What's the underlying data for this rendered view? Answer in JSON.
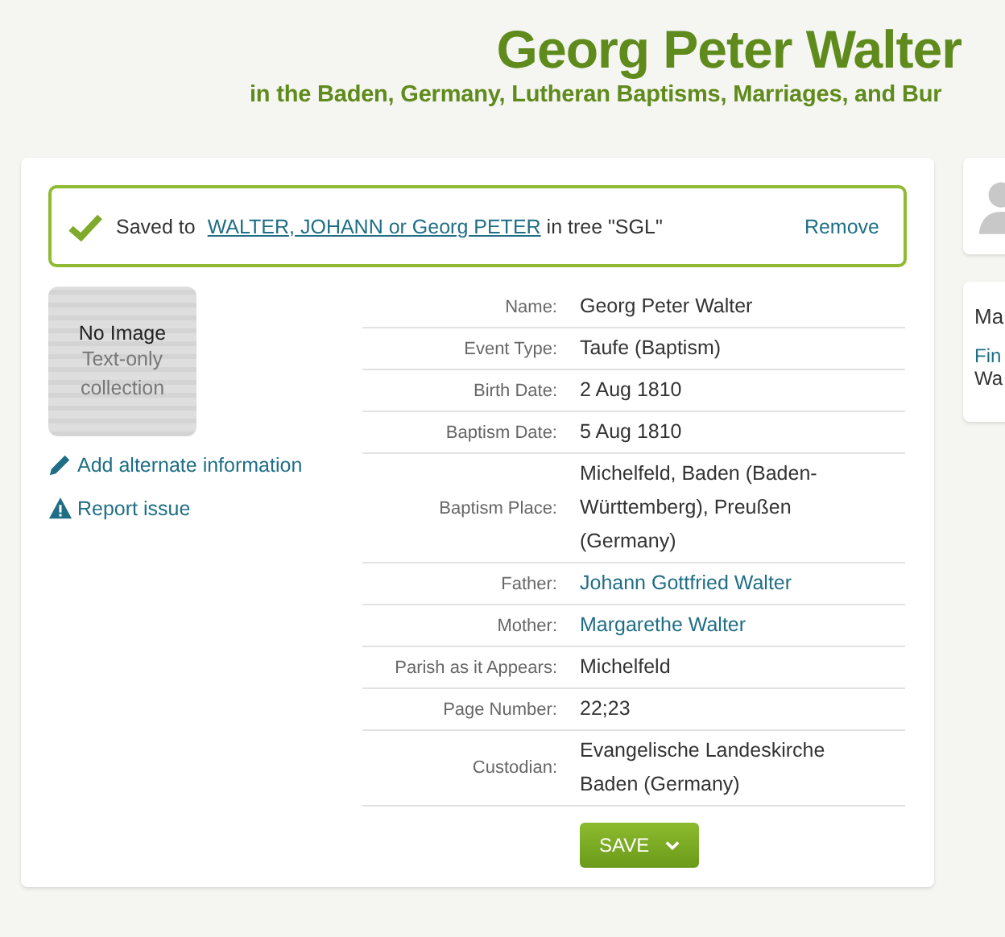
{
  "header": {
    "title": "Georg Peter Walter",
    "subtitle": "in the Baden, Germany, Lutheran Baptisms, Marriages, and Bur"
  },
  "saved_banner": {
    "prefix": "Saved to",
    "person_link": "WALTER, JOHANN or Georg PETER",
    "suffix": "in tree \"SGL\"",
    "remove": "Remove"
  },
  "image_placeholder": {
    "title": "No Image",
    "subtitle": "Text-only collection"
  },
  "actions": [
    {
      "label": "Add alternate information",
      "kind": "edit"
    },
    {
      "label": "Report issue",
      "kind": "warning"
    }
  ],
  "details": [
    {
      "label": "Name:",
      "value": "Georg Peter Walter",
      "kind": "text"
    },
    {
      "label": "Event Type:",
      "value": "Taufe (Baptism)",
      "kind": "text"
    },
    {
      "label": "Birth Date:",
      "value": "2 Aug 1810",
      "kind": "text"
    },
    {
      "label": "Baptism Date:",
      "value": "5 Aug 1810",
      "kind": "text"
    },
    {
      "label": "Baptism Place:",
      "value": "Michelfeld, Baden (Baden-Württemberg), Preußen (Germany)",
      "kind": "text"
    },
    {
      "label": "Father:",
      "value": "Johann Gottfried Walter",
      "kind": "link"
    },
    {
      "label": "Mother:",
      "value": "Margarethe Walter",
      "kind": "link"
    },
    {
      "label": "Parish as it Appears:",
      "value": "Michelfeld",
      "kind": "text"
    },
    {
      "label": "Page Number:",
      "value": "22;23",
      "kind": "text"
    },
    {
      "label": "Custodian:",
      "value": "Evangelische Landeskirche Baden (Germany)",
      "kind": "text"
    }
  ],
  "save_button": "SAVE",
  "side_card": {
    "title": "Ma",
    "link": "Fin",
    "text": "Wa"
  }
}
